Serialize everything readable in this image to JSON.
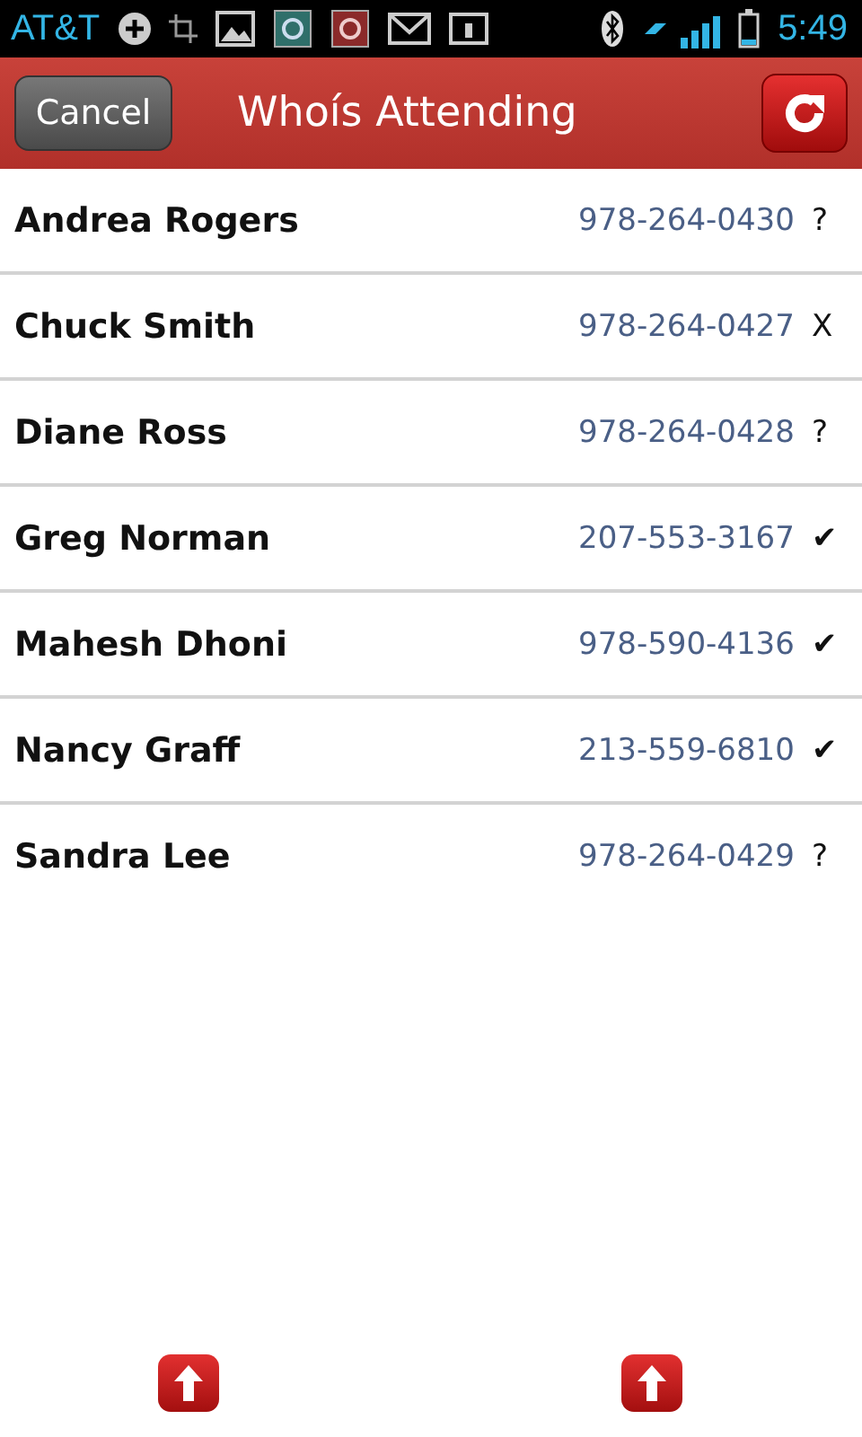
{
  "status_bar": {
    "carrier": "AT&T",
    "time": "5:49"
  },
  "header": {
    "cancel": "Cancel",
    "title": "Whoís Attending"
  },
  "attendees": [
    {
      "name": "Andrea Rogers",
      "phone": "978-264-0430",
      "status": "?"
    },
    {
      "name": "Chuck Smith",
      "phone": "978-264-0427",
      "status": "X"
    },
    {
      "name": "Diane Ross",
      "phone": "978-264-0428",
      "status": "?"
    },
    {
      "name": "Greg Norman",
      "phone": "207-553-3167",
      "status": "✔"
    },
    {
      "name": "Mahesh Dhoni",
      "phone": "978-590-4136",
      "status": "✔"
    },
    {
      "name": "Nancy Graff",
      "phone": "213-559-6810",
      "status": "✔"
    },
    {
      "name": "Sandra Lee",
      "phone": "978-264-0429",
      "status": "?"
    }
  ]
}
